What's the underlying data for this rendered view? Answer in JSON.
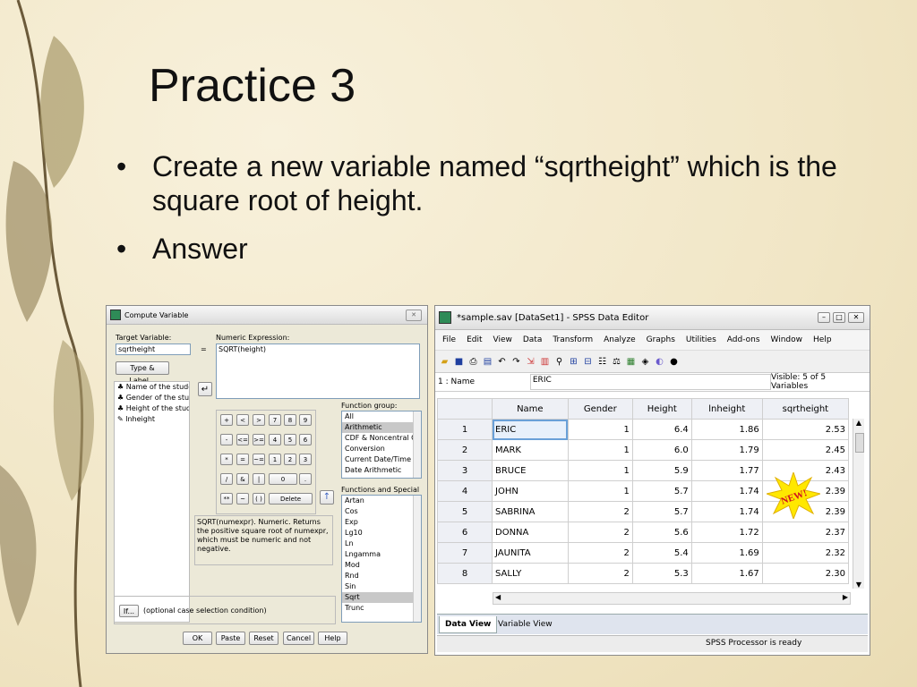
{
  "slide": {
    "title": "Practice 3",
    "bullets": [
      "Create a new variable named “sqrtheight” which is the square root of height.",
      "Answer"
    ]
  },
  "compute_dialog": {
    "title": "Compute Variable",
    "target_variable_label": "Target Variable:",
    "target_variable_value": "sqrtheight",
    "equals": "=",
    "numeric_expression_label": "Numeric Expression:",
    "numeric_expression_value": "SQRT(height)",
    "type_label_button": "Type & Label...",
    "variables": [
      "Name of the students [N...",
      "Gender of the students ...",
      "Height of the students [...",
      "lnheight"
    ],
    "keypad": [
      "+",
      "<",
      ">",
      "7",
      "8",
      "9",
      "-",
      "<=",
      ">=",
      "4",
      "5",
      "6",
      "*",
      "=",
      "~=",
      "1",
      "2",
      "3",
      "/",
      "&",
      "|",
      "0",
      ".",
      "**",
      "~",
      "( )",
      "Delete"
    ],
    "function_group_label": "Function group:",
    "function_groups": [
      "All",
      "Arithmetic",
      "CDF & Noncentral CDF",
      "Conversion",
      "Current Date/Time",
      "Date Arithmetic"
    ],
    "functions_label": "Functions and Special Variables:",
    "functions": [
      "Artan",
      "Cos",
      "Exp",
      "Lg10",
      "Ln",
      "Lngamma",
      "Mod",
      "Rnd",
      "Sin",
      "Sqrt",
      "Trunc"
    ],
    "description": "SQRT(numexpr). Numeric. Returns the positive square root of numexpr, which must be numeric and not negative.",
    "if_button": "If...",
    "if_label": "(optional case selection condition)",
    "buttons": {
      "ok": "OK",
      "paste": "Paste",
      "reset": "Reset",
      "cancel": "Cancel",
      "help": "Help"
    }
  },
  "data_editor": {
    "title": "*sample.sav [DataSet1] - SPSS Data Editor",
    "menu": [
      "File",
      "Edit",
      "View",
      "Data",
      "Transform",
      "Analyze",
      "Graphs",
      "Utilities",
      "Add-ons",
      "Window",
      "Help"
    ],
    "cell_ref": "1 : Name",
    "cell_value": "ERIC",
    "visible": "Visible: 5 of 5 Variables",
    "columns": [
      "Name",
      "Gender",
      "Height",
      "lnheight",
      "sqrtheight"
    ],
    "rows": [
      {
        "n": "1",
        "name": "ERIC",
        "gender": "1",
        "height": "6.4",
        "ln": "1.86",
        "sq": "2.53"
      },
      {
        "n": "2",
        "name": "MARK",
        "gender": "1",
        "height": "6.0",
        "ln": "1.79",
        "sq": "2.45"
      },
      {
        "n": "3",
        "name": "BRUCE",
        "gender": "1",
        "height": "5.9",
        "ln": "1.77",
        "sq": "2.43"
      },
      {
        "n": "4",
        "name": "JOHN",
        "gender": "1",
        "height": "5.7",
        "ln": "1.74",
        "sq": "2.39"
      },
      {
        "n": "5",
        "name": "SABRINA",
        "gender": "2",
        "height": "5.7",
        "ln": "1.74",
        "sq": "2.39"
      },
      {
        "n": "6",
        "name": "DONNA",
        "gender": "2",
        "height": "5.6",
        "ln": "1.72",
        "sq": "2.37"
      },
      {
        "n": "7",
        "name": "JAUNITA",
        "gender": "2",
        "height": "5.4",
        "ln": "1.69",
        "sq": "2.32"
      },
      {
        "n": "8",
        "name": "SALLY",
        "gender": "2",
        "height": "5.3",
        "ln": "1.67",
        "sq": "2.30"
      }
    ],
    "new_badge": "NEW!",
    "tabs": [
      "Data View",
      "Variable View"
    ],
    "status": "SPSS  Processor is ready",
    "colors": {
      "badge": "#ffe800",
      "badge_text": "#d2141e",
      "tab_active": "#ffffff"
    }
  }
}
